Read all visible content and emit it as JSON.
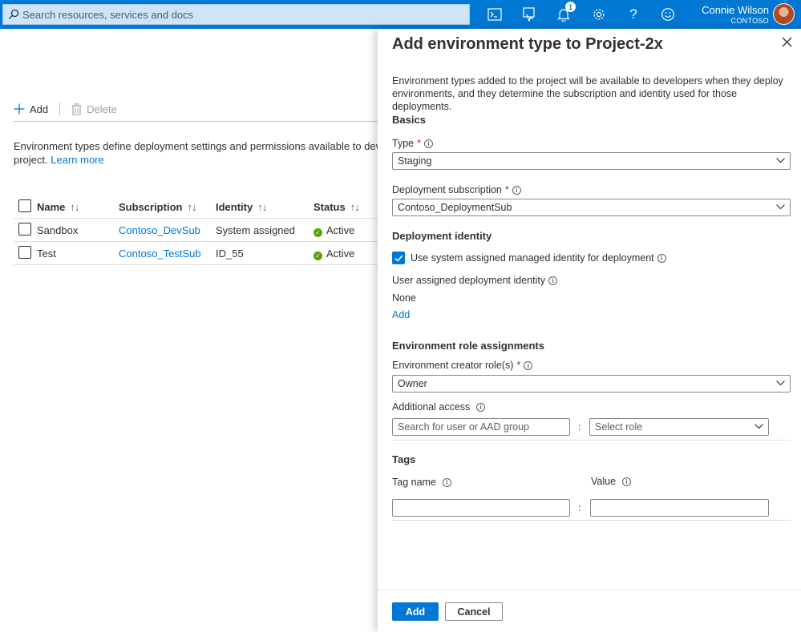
{
  "topbar": {
    "search_placeholder": "Search resources, services and docs",
    "notification_count": "1",
    "user_name": "Connie Wilson",
    "tenant": "CONTOSO",
    "icons": [
      "cloud-shell-icon",
      "directory-filter-icon",
      "bell-icon",
      "gear-icon",
      "help-icon",
      "feedback-icon"
    ]
  },
  "background": {
    "add_label": "Add",
    "delete_label": "Delete",
    "description": "Environment types define deployment settings and permissions available to developers",
    "description_line2": "project.",
    "learn_more": "Learn more",
    "table": {
      "columns": [
        "Name",
        "Subscription",
        "Identity",
        "Status"
      ],
      "rows": [
        {
          "name": "Sandbox",
          "subscription": "Contoso_DevSub",
          "identity": "System assigned",
          "status": "Active"
        },
        {
          "name": "Test",
          "subscription": "Contoso_TestSub",
          "identity": "ID_55",
          "status": "Active"
        }
      ]
    }
  },
  "panel": {
    "title": "Add environment type to Project-2x",
    "intro": "Environment types added to the project will be available to developers when they deploy environments, and they determine the subscription and identity used for those deployments.",
    "basics_heading": "Basics",
    "type_label": "Type",
    "type_value": "Staging",
    "subscription_label": "Deployment subscription",
    "subscription_value": "Contoso_DeploymentSub",
    "identity_heading": "Deployment identity",
    "use_system_identity_label": "Use system assigned managed identity for deployment",
    "use_system_identity_checked": true,
    "user_identity_label": "User assigned deployment identity",
    "user_identity_value": "None",
    "user_identity_add": "Add",
    "roles_heading": "Environment role assignments",
    "creator_role_label": "Environment creator role(s)",
    "creator_role_value": "Owner",
    "additional_access_label": "Additional access",
    "user_search_placeholder": "Search for user or AAD group",
    "select_role_placeholder": "Select role",
    "tags_heading": "Tags",
    "tag_name_label": "Tag name",
    "tag_value_label": "Value",
    "tag_name_value": "",
    "tag_value_value": "",
    "add_button": "Add",
    "cancel_button": "Cancel"
  },
  "colors": {
    "accent": "#0078d4",
    "required": "#a4262c",
    "status_active": "#57a300"
  }
}
